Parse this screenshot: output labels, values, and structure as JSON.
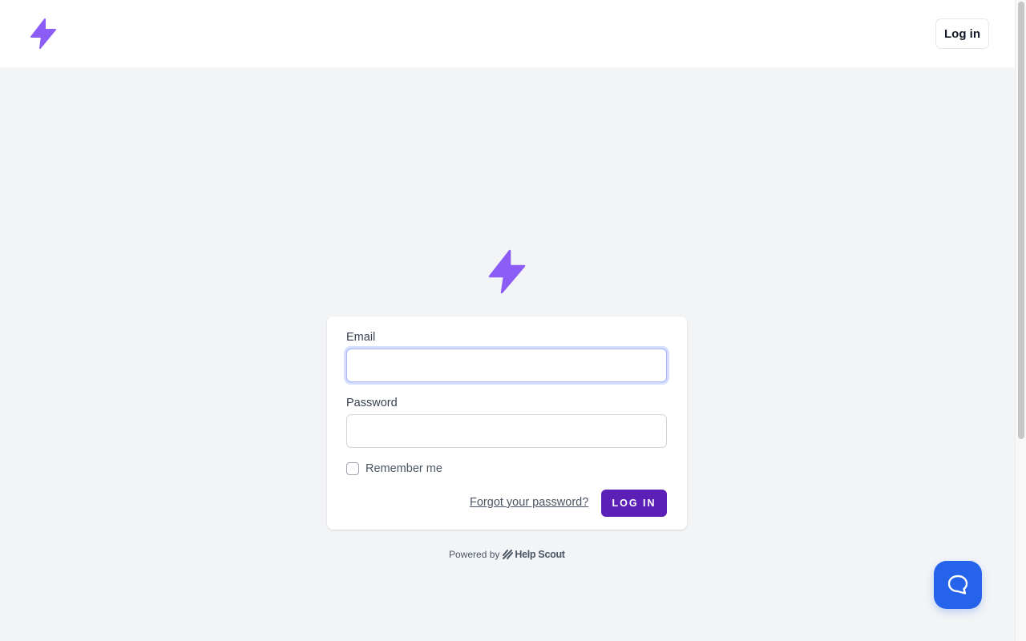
{
  "header": {
    "logo_icon": "lightning-bolt-icon",
    "login_label": "Log in"
  },
  "brand": {
    "accent": "#8b5cf6",
    "button": "#5b21b6",
    "beacon": "#2563eb"
  },
  "form": {
    "email_label": "Email",
    "email_value": "",
    "password_label": "Password",
    "password_value": "",
    "remember_label": "Remember me",
    "remember_checked": false,
    "forgot_label": "Forgot your password?",
    "submit_label": "Log in"
  },
  "footer": {
    "powered_by": "Powered by",
    "provider": "Help Scout"
  },
  "beacon": {
    "icon": "chat-bubble-icon"
  }
}
